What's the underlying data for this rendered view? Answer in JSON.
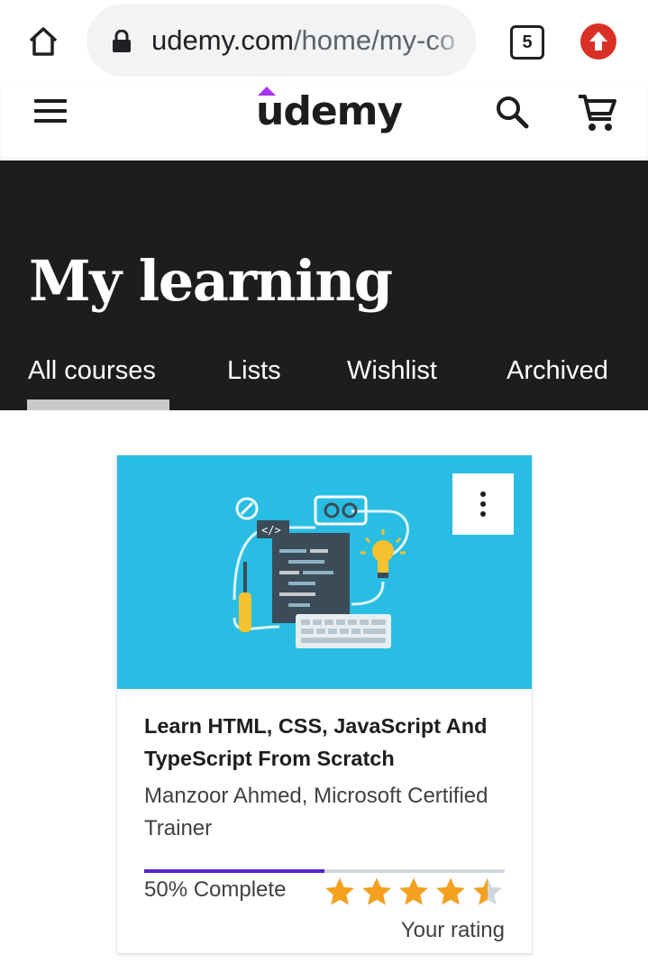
{
  "browser": {
    "url_domain": "udemy.com",
    "url_path": "/home/my-co",
    "tab_count": "5"
  },
  "header": {
    "logo_text": "udemy"
  },
  "hero": {
    "title": "My learning",
    "tabs": [
      {
        "label": "All courses",
        "active": true
      },
      {
        "label": "Lists",
        "active": false
      },
      {
        "label": "Wishlist",
        "active": false
      },
      {
        "label": "Archived",
        "active": false
      }
    ]
  },
  "course": {
    "title": "Learn HTML, CSS, JavaScript And TypeScript From Scratch",
    "instructor": "Manzoor Ahmed, Microsoft Certified Trainer",
    "progress_percent": 50,
    "progress_label": "50% Complete",
    "rating": 4.5,
    "rating_label": "Your rating"
  },
  "colors": {
    "hero_bg": "#1c1d1f",
    "progress": "#5624d0",
    "star": "#f3a11e",
    "thumbnail_bg": "#29bde3",
    "update_badge": "#d93025"
  },
  "icons": [
    "home-icon",
    "lock-icon",
    "tab-switcher-icon",
    "update-icon",
    "menu-icon",
    "search-icon",
    "cart-icon",
    "more-vertical-icon",
    "star-icon"
  ]
}
